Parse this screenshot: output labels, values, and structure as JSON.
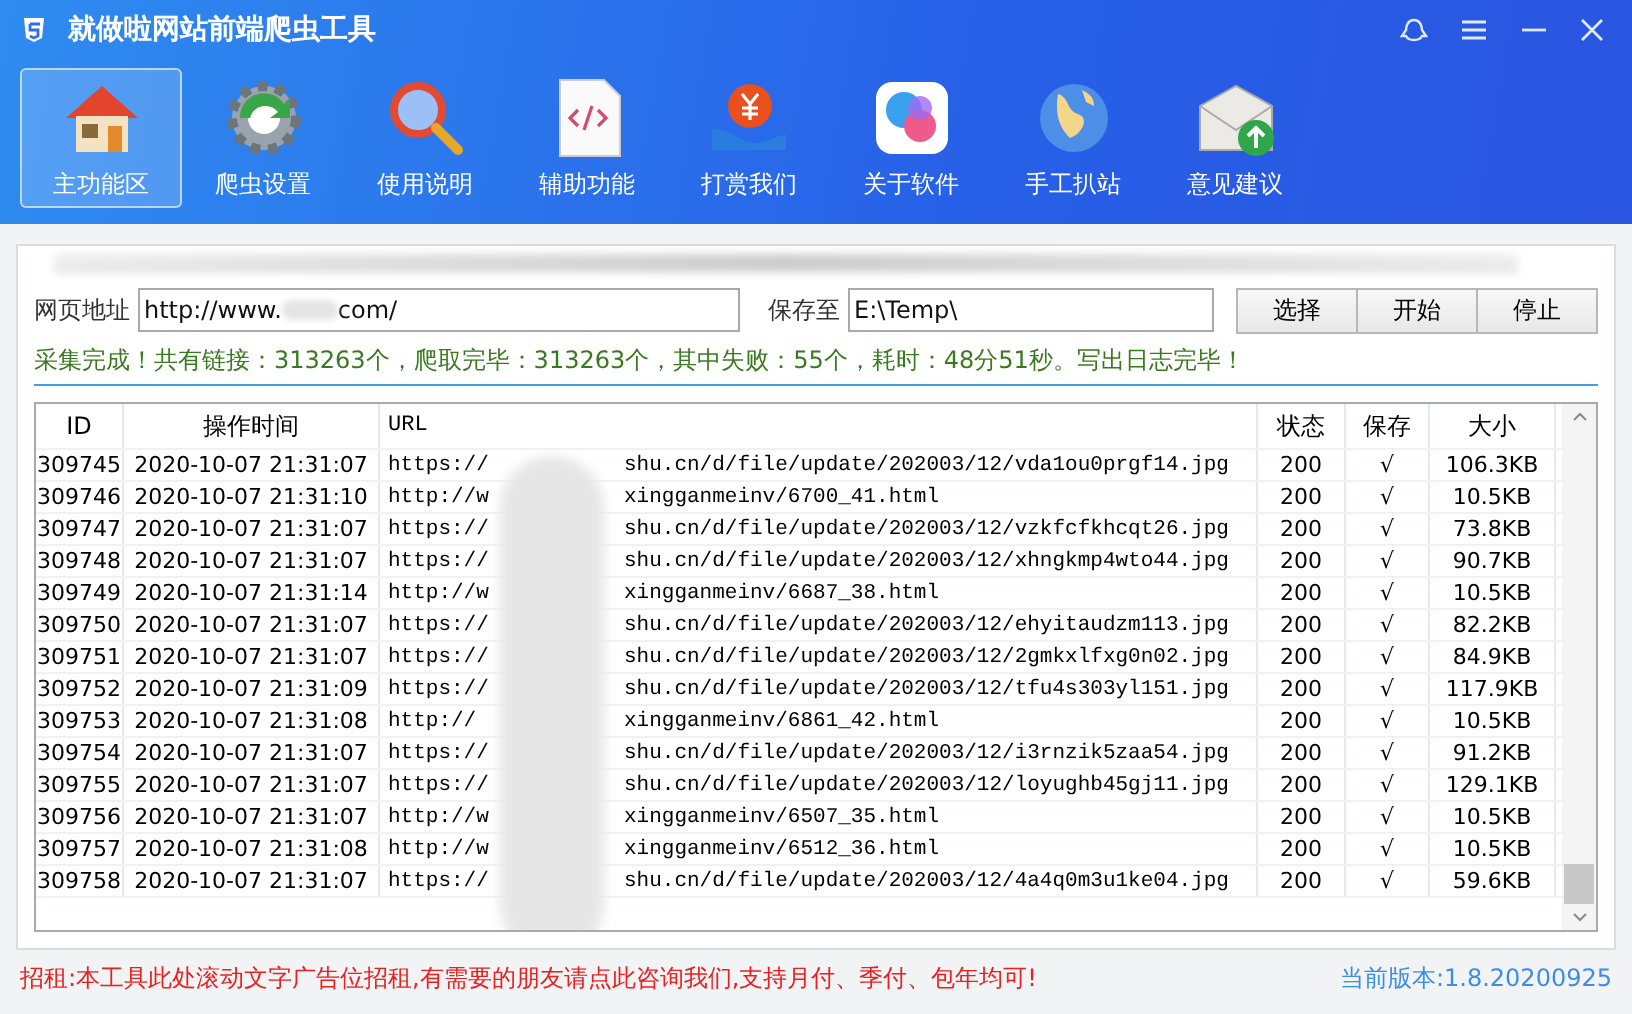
{
  "window": {
    "title": "就做啦网站前端爬虫工具"
  },
  "toolbar": [
    {
      "label": "主功能区",
      "selected": true
    },
    {
      "label": "爬虫设置",
      "selected": false
    },
    {
      "label": "使用说明",
      "selected": false
    },
    {
      "label": "辅助功能",
      "selected": false
    },
    {
      "label": "打赏我们",
      "selected": false
    },
    {
      "label": "关于软件",
      "selected": false
    },
    {
      "label": "手工扒站",
      "selected": false
    },
    {
      "label": "意见建议",
      "selected": false
    }
  ],
  "form": {
    "url_label": "网页地址",
    "url_value_start": "http://www.",
    "url_value_end": "com/",
    "save_label": "保存至",
    "save_value": "E:\\Temp\\",
    "buttons": [
      "选择",
      "开始",
      "停止"
    ]
  },
  "status": "采集完成！共有链接：313263个，爬取完毕：313263个，其中失败：55个，耗时：48分51秒。写出日志完毕！",
  "table": {
    "columns": [
      "ID",
      "操作时间",
      "URL",
      "状态",
      "保存",
      "大小"
    ],
    "rows": [
      {
        "id": "309745",
        "time": "2020-10-07 21:31:07",
        "url_start": "https://",
        "url_end": "shu.cn/d/file/update/202003/12/vda1ou0prgf14.jpg",
        "status": "200",
        "saved": "√",
        "size": "106.3KB"
      },
      {
        "id": "309746",
        "time": "2020-10-07 21:31:10",
        "url_start": "http://w",
        "url_end": "xingganmeinv/6700_41.html",
        "status": "200",
        "saved": "√",
        "size": "10.5KB"
      },
      {
        "id": "309747",
        "time": "2020-10-07 21:31:07",
        "url_start": "https://",
        "url_end": "shu.cn/d/file/update/202003/12/vzkfcfkhcqt26.jpg",
        "status": "200",
        "saved": "√",
        "size": "73.8KB"
      },
      {
        "id": "309748",
        "time": "2020-10-07 21:31:07",
        "url_start": "https://",
        "url_end": "shu.cn/d/file/update/202003/12/xhngkmp4wto44.jpg",
        "status": "200",
        "saved": "√",
        "size": "90.7KB"
      },
      {
        "id": "309749",
        "time": "2020-10-07 21:31:14",
        "url_start": "http://w",
        "url_end": "xingganmeinv/6687_38.html",
        "status": "200",
        "saved": "√",
        "size": "10.5KB"
      },
      {
        "id": "309750",
        "time": "2020-10-07 21:31:07",
        "url_start": "https://",
        "url_end": "shu.cn/d/file/update/202003/12/ehyitaudzm113.jpg",
        "status": "200",
        "saved": "√",
        "size": "82.2KB"
      },
      {
        "id": "309751",
        "time": "2020-10-07 21:31:07",
        "url_start": "https://",
        "url_end": "shu.cn/d/file/update/202003/12/2gmkxlfxg0n02.jpg",
        "status": "200",
        "saved": "√",
        "size": "84.9KB"
      },
      {
        "id": "309752",
        "time": "2020-10-07 21:31:09",
        "url_start": "https://",
        "url_end": "shu.cn/d/file/update/202003/12/tfu4s303yl151.jpg",
        "status": "200",
        "saved": "√",
        "size": "117.9KB"
      },
      {
        "id": "309753",
        "time": "2020-10-07 21:31:08",
        "url_start": "http://",
        "url_end": "xingganmeinv/6861_42.html",
        "status": "200",
        "saved": "√",
        "size": "10.5KB"
      },
      {
        "id": "309754",
        "time": "2020-10-07 21:31:07",
        "url_start": "https://",
        "url_end": "shu.cn/d/file/update/202003/12/i3rnzik5zaa54.jpg",
        "status": "200",
        "saved": "√",
        "size": "91.2KB"
      },
      {
        "id": "309755",
        "time": "2020-10-07 21:31:07",
        "url_start": "https://",
        "url_end": "shu.cn/d/file/update/202003/12/loyughb45gj11.jpg",
        "status": "200",
        "saved": "√",
        "size": "129.1KB"
      },
      {
        "id": "309756",
        "time": "2020-10-07 21:31:07",
        "url_start": "http://w",
        "url_end": "xingganmeinv/6507_35.html",
        "status": "200",
        "saved": "√",
        "size": "10.5KB"
      },
      {
        "id": "309757",
        "time": "2020-10-07 21:31:08",
        "url_start": "http://w",
        "url_end": "xingganmeinv/6512_36.html",
        "status": "200",
        "saved": "√",
        "size": "10.5KB"
      },
      {
        "id": "309758",
        "time": "2020-10-07 21:31:07",
        "url_start": "https://",
        "url_end": "shu.cn/d/file/update/202003/12/4a4q0m3u1ke04.jpg",
        "status": "200",
        "saved": "√",
        "size": "59.6KB"
      }
    ]
  },
  "footer": {
    "ad": "招租:本工具此处滚动文字广告位招租,有需要的朋友请点此咨询我们,支持月付、季付、包年均可!",
    "version": "当前版本:1.8.20200925"
  }
}
